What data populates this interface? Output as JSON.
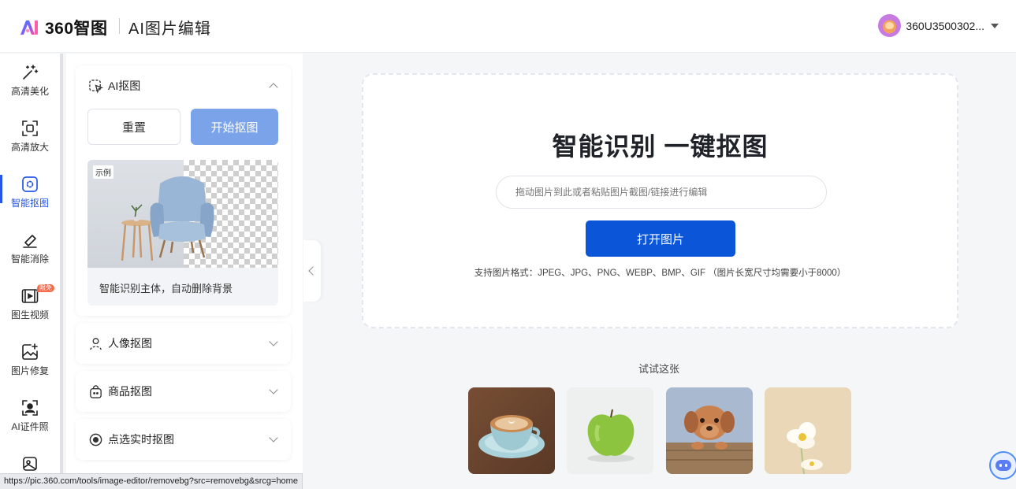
{
  "header": {
    "logo_text": "360智图",
    "app_title": "AI图片编辑",
    "username": "360U3500302..."
  },
  "nav": {
    "items": [
      {
        "label": "高清美化",
        "icon": "magic-wand-icon"
      },
      {
        "label": "高清放大",
        "icon": "upscale-icon"
      },
      {
        "label": "智能抠图",
        "icon": "cutout-icon"
      },
      {
        "label": "智能消除",
        "icon": "eraser-icon"
      },
      {
        "label": "图生视频",
        "icon": "video-icon",
        "badge": "限免"
      },
      {
        "label": "图片修复",
        "icon": "image-repair-icon"
      },
      {
        "label": "AI证件照",
        "icon": "id-photo-icon"
      }
    ],
    "active_index": 2
  },
  "panel": {
    "ai_cutout": {
      "title": "AI抠图",
      "reset_label": "重置",
      "start_label": "开始抠图",
      "example_tag": "示例",
      "example_caption": "智能识别主体，自动删除背景"
    },
    "sections": [
      {
        "title": "人像抠图",
        "icon": "person-icon"
      },
      {
        "title": "商品抠图",
        "icon": "shopping-bag-icon"
      },
      {
        "title": "点选实时抠图",
        "icon": "target-icon"
      }
    ]
  },
  "upload": {
    "headline": "智能识别 一键抠图",
    "input_placeholder": "拖动图片到此或者粘贴图片截图/链接进行编辑",
    "open_button": "打开图片",
    "formats_text": "支持图片格式：JPEG、JPG、PNG、WEBP、BMP、GIF （图片长宽尺寸均需要小于8000）"
  },
  "samples": {
    "label": "试试这张",
    "items": [
      "coffee-cup-image",
      "green-apple-image",
      "puppy-image",
      "flower-image"
    ]
  },
  "status_bar": {
    "url": "https://pic.360.com/tools/image-editor/removebg?src=removebg&srcg=home"
  },
  "colors": {
    "accent": "#2656e8",
    "primary_button": "#0b55d9",
    "start_button": "#7ba3ea"
  }
}
